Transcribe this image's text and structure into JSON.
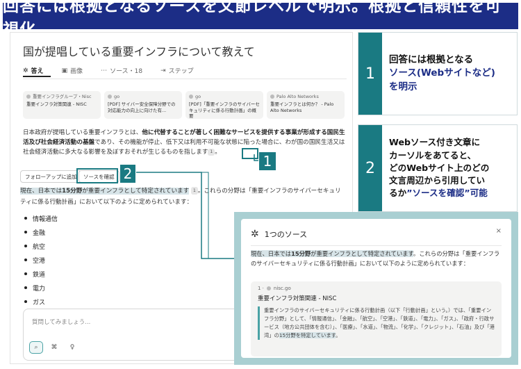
{
  "banner": {
    "title": "回答には根拠となるソースを文節レベルで明示。根拠と信頼性を可視化"
  },
  "screen": {
    "question": "国が提唱している重要インフラについて教えて",
    "tabs": [
      {
        "label": "答え"
      },
      {
        "label": "画像"
      },
      {
        "label": "ソース・18"
      },
      {
        "label": "ステップ"
      }
    ],
    "source_cards": [
      {
        "site": "重要インフラグループ・Nisc",
        "title": "重要インフラ対策関連 - NISC"
      },
      {
        "site": "go",
        "title": "[PDF] サイバー安全保障分野での対応能力の向上に向けた有..."
      },
      {
        "site": "go",
        "title": "[PDF]「重要インフラのサイバーセキュリティに係る行動計画」の概要"
      },
      {
        "site": "Palo Alto Networks",
        "title": "重要インフラとは何か？ - Palo Alto Networks"
      }
    ],
    "answer_part1": "日本政府が提唱している重要インフラとは、",
    "answer_bold": "他に代替することが著しく困難なサービスを提供する事業が形成する国民生活及び社会経済活動の基盤",
    "answer_part2": "であり、その機能が停止、低下又は利用不可能な状態に陥った場合に、わが国の国民生活又は社会経済活動に多大なる影響を及ぼすおそれが生じるものを指します",
    "cite1": "1",
    "period": "。",
    "followup_button": "フォローアップに追加",
    "confirm_button": "ソースを確認",
    "highlight_pre": "現在、日本では",
    "highlight_bold": "15分野",
    "highlight_post": "が重要インフラとして特定されています",
    "cite2": "1",
    "after_highlight": "。これらの分野は「重要インフラのサイバーセキュリティに係る行動計画」において以下のように定められています：",
    "sectors": [
      "情報通信",
      "金融",
      "航空",
      "空港",
      "鉄道",
      "電力",
      "ガス"
    ],
    "ask_placeholder": "質問してみましょう..."
  },
  "labels": {
    "one": "1",
    "two": "2"
  },
  "callouts": [
    {
      "num": "1",
      "line1": "回答には根拠となる",
      "line2": "ソース(Webサイトなど)",
      "line3": "を明示"
    },
    {
      "num": "2",
      "line1": "Webソース付き文章に",
      "line2": "カーソルをあてると、",
      "line3": "どのWebサイト上のどの",
      "line4": "文言周辺から引用してい",
      "line5a": "るか",
      "line5b": "”ソースを確認”可能"
    }
  ],
  "popup": {
    "title": "1つのソース",
    "close": "×",
    "quote_pre": "現在、日本では",
    "quote_bold": "15分野",
    "quote_post": "が重要インフラとして特定されています",
    "quote_rest": "。これらの分野は「重要インフラのサイバーセキュリティに係る行動計画」において以下のように定められています：",
    "source_num": "1 ·",
    "source_site": "nisc.go",
    "source_title": "重要インフラ対策関連 - NISC",
    "source_desc": "重要インフラのサイバーセキュリティに係る行動計画（以下「行動計画」という。）では、「重要インフラ分野」として、「情報通信」、「金融」、「航空」、「空港」、「鉄道」、「電力」、「ガス」、「政府・行政サービス（地方公共団体を含む）」、「医療」、「水道」、「物流」、「化学」、「クレジット」、「石油」及び「港湾」の",
    "source_desc_hl": "15分野を特定しています",
    "source_desc_end": "。"
  },
  "colors": {
    "navy": "#1c2d86",
    "teal": "#1a7a82",
    "highlight": "#d7e4e8"
  }
}
